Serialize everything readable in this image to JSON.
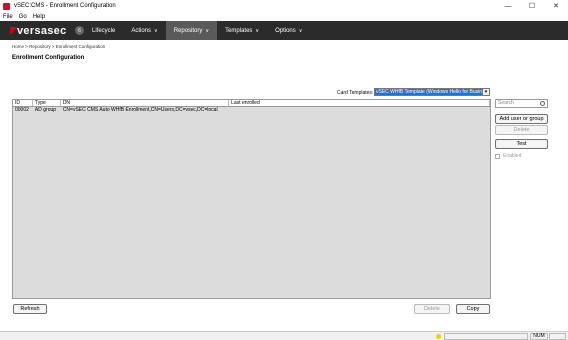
{
  "window": {
    "title": "vSEC:CMS - Enrollment Configuration",
    "controls": {
      "minimize": "—",
      "maximize": "☐",
      "close": "✕"
    }
  },
  "menu": [
    "File",
    "Go",
    "Help"
  ],
  "nav": {
    "logo": "versasec",
    "badge": "6",
    "items": [
      {
        "label": "Lifecycle",
        "chevron": ""
      },
      {
        "label": "Actions",
        "chevron": "∨"
      },
      {
        "label": "Repository",
        "chevron": "∨"
      },
      {
        "label": "Templates",
        "chevron": "∨"
      },
      {
        "label": "Options",
        "chevron": "∨"
      }
    ]
  },
  "breadcrumb": "Home > Repository > Enrollment Configuration",
  "page_title": "Enrollment Configuration",
  "card_templates": {
    "label": "Card Templates:",
    "selected": "vSEC WHfB Template (Windows Hello for Busine",
    "arrow": "▾"
  },
  "table": {
    "columns": [
      "ID",
      "Type",
      "DN",
      "Last enrolled"
    ],
    "rows": [
      [
        "00002",
        "AD group",
        "CN=vSEC CMS Auto WHfB Enrollment,CN=Users,DC=vsec,DC=local",
        ""
      ]
    ]
  },
  "side": {
    "search_placeholder": "Search",
    "add_button": "Add user or group",
    "delete_button": "Delete",
    "test_button": "Test",
    "enabled_label": "Enabled"
  },
  "footer": {
    "refresh": "Refresh",
    "delete": "Delete",
    "copy": "Copy"
  },
  "status": {
    "num": "NUM"
  }
}
